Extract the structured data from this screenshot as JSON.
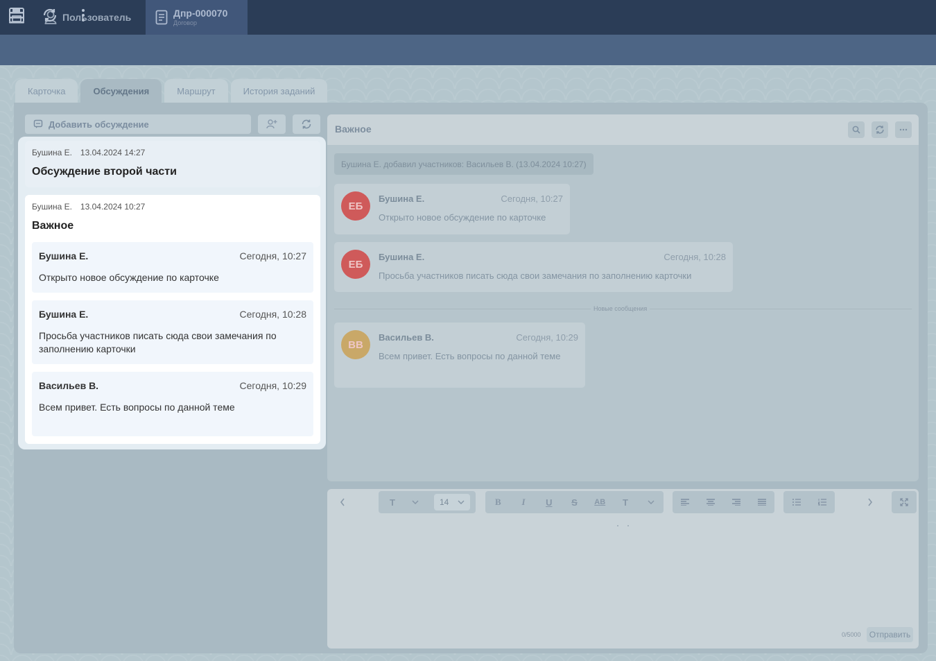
{
  "header": {
    "user_label": "Пользователь",
    "doc_number": "Дпр-000070",
    "doc_type": "Договор"
  },
  "tabs": [
    {
      "label": "Карточка"
    },
    {
      "label": "Обсуждения"
    },
    {
      "label": "Маршрут"
    },
    {
      "label": "История заданий"
    }
  ],
  "discussions": {
    "add_label": "Добавить обсуждение",
    "items": [
      {
        "author": "Бушина Е.",
        "date": "13.04.2024 14:27",
        "title": "Обсуждение второй части"
      },
      {
        "author": "Бушина Е.",
        "date": "13.04.2024 10:27",
        "title": "Важное"
      }
    ],
    "messages": [
      {
        "author": "Бушина Е.",
        "date": "Сегодня, 10:27",
        "text": "Открыто новое обсуждение по карточке"
      },
      {
        "author": "Бушина Е.",
        "date": "Сегодня, 10:28",
        "text": "Просьба участников писать сюда свои замечания по заполнению карточки"
      },
      {
        "author": "Васильев В.",
        "date": "Сегодня, 10:29",
        "text": "Всем привет. Есть вопросы по данной теме"
      }
    ]
  },
  "chat": {
    "title": "Важное",
    "system_note": "Бушина Е. добавил участников: Васильев В. (13.04.2024 10:27)",
    "new_messages_label": "Новые сообщения",
    "messages": [
      {
        "initials": "ЕБ",
        "avatar_color": "#cf5a5a",
        "author": "Бушина Е.",
        "date": "Сегодня, 10:27",
        "text": "Открыто новое обсуждение по карточке"
      },
      {
        "initials": "ЕБ",
        "avatar_color": "#cf5a5a",
        "author": "Бушина Е.",
        "date": "Сегодня, 10:28",
        "text": "Просьба участников писать сюда свои замечания по заполнению карточки"
      },
      {
        "initials": "ВВ",
        "avatar_color": "#c9a868",
        "author": "Васильев В.",
        "date": "Сегодня, 10:29",
        "text": "Всем привет. Есть вопросы по данной теме"
      }
    ]
  },
  "editor": {
    "font_size": "14",
    "text_style_glyph": "T",
    "bold_glyph": "B",
    "italic_glyph": "I",
    "underline_glyph": "U",
    "strike_glyph": "S",
    "highlight_glyph": "AB",
    "color_glyph": "T",
    "counter": "0/5000",
    "send_label": "Отправить"
  },
  "colors": {
    "topbar": "#2b3d57",
    "toolbar": "#4d6585",
    "avatar_red": "#cf5a5a",
    "avatar_gold": "#c9a868"
  }
}
